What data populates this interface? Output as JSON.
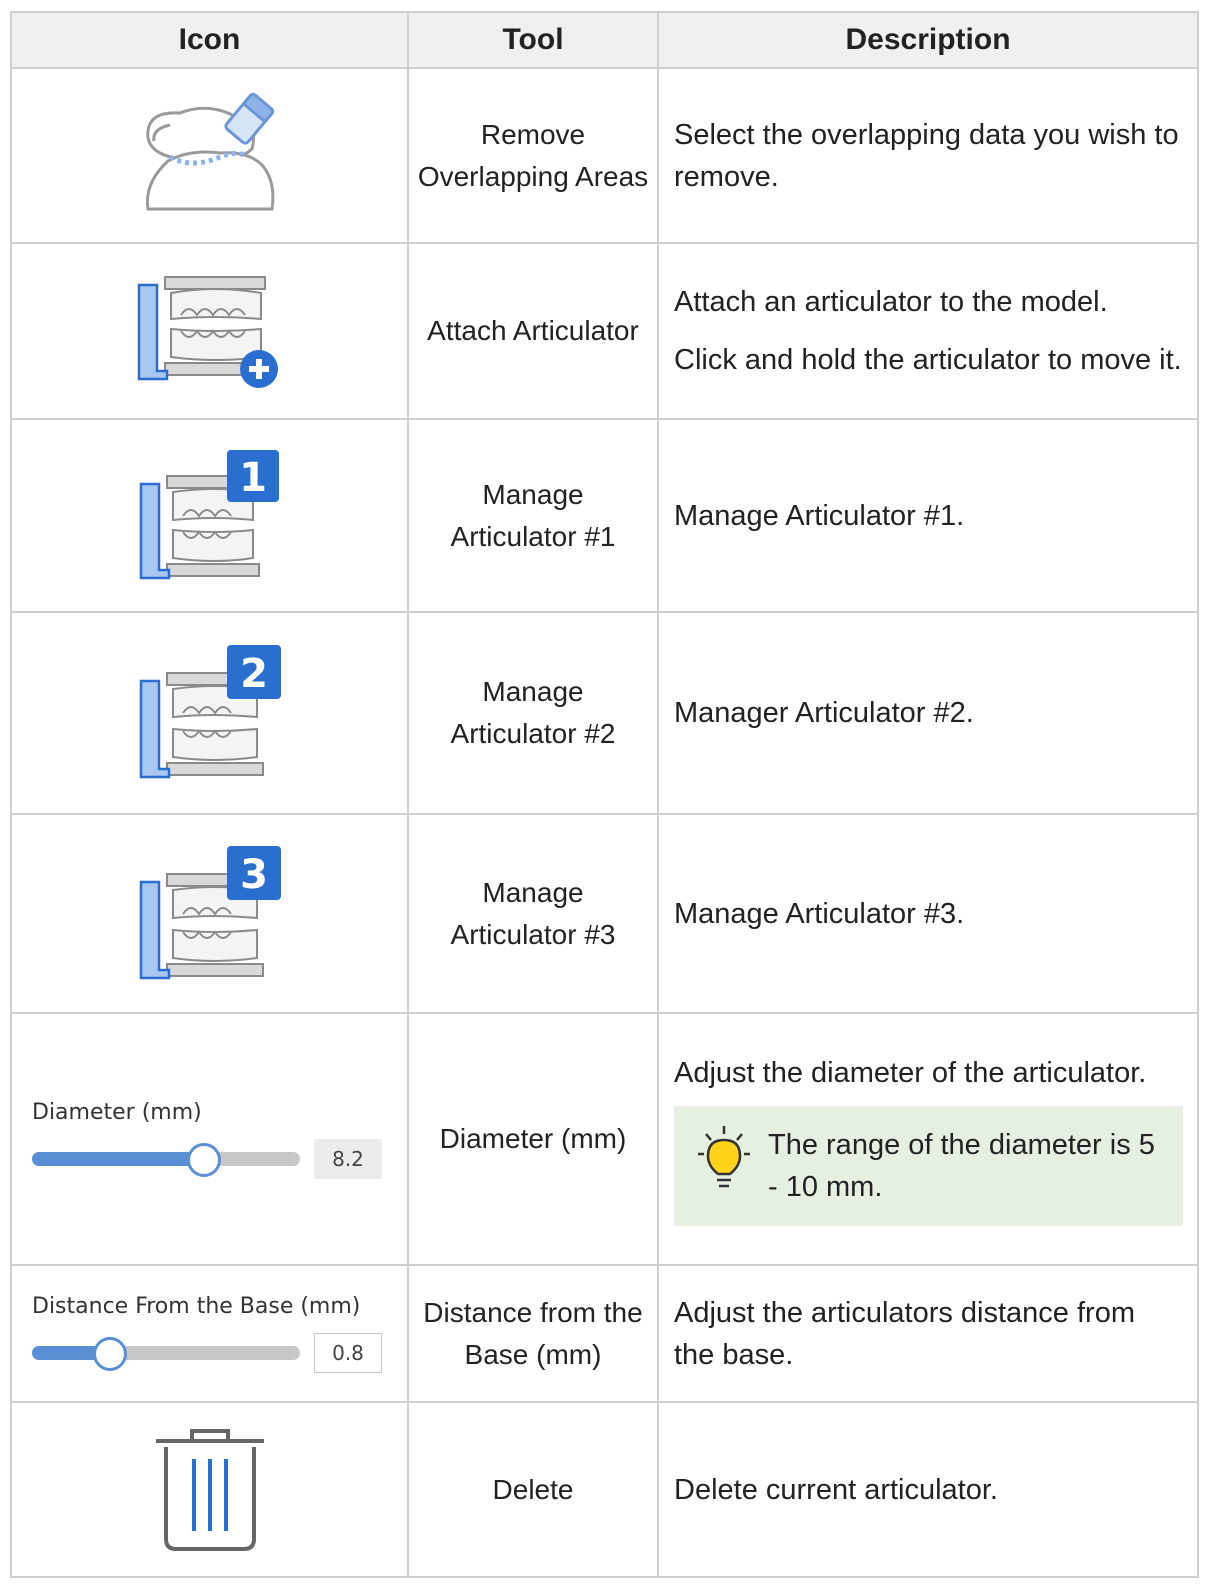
{
  "headers": {
    "icon": "Icon",
    "tool": "Tool",
    "description": "Description"
  },
  "rows": [
    {
      "tool": "Remove Overlapping Areas",
      "desc": [
        "Select the overlapping data you wish to remove."
      ]
    },
    {
      "tool": "Attach Articulator",
      "desc": [
        "Attach an articulator to the model.",
        "Click and hold the articulator to move it."
      ]
    },
    {
      "tool": "Manage Articulator #1",
      "desc": [
        "Manage Articulator #1."
      ],
      "badge": "1"
    },
    {
      "tool": "Manage Articulator #2",
      "desc": [
        "Manager Articulator #2."
      ],
      "badge": "2"
    },
    {
      "tool": "Manage Articulator #3",
      "desc": [
        "Manage Articulator #3."
      ],
      "badge": "3"
    },
    {
      "tool": "Diameter (mm)",
      "desc": [
        "Adjust the diameter of the articulator."
      ],
      "tip": "The range of the diameter is 5 - 10 mm.",
      "slider": {
        "label": "Diameter (mm)",
        "value": "8.2",
        "fraction": 0.64
      }
    },
    {
      "tool": "Distance from the Base (mm)",
      "desc": [
        "Adjust the articulators distance from the base."
      ],
      "slider": {
        "label": "Distance From the Base (mm)",
        "value": "0.8",
        "fraction": 0.29
      }
    },
    {
      "tool": "Delete",
      "desc": [
        "Delete current articulator."
      ]
    }
  ],
  "colors": {
    "accent": "#2a6fd0",
    "tip_bg": "#e6f0e2",
    "header_bg": "#f0f0f0"
  }
}
